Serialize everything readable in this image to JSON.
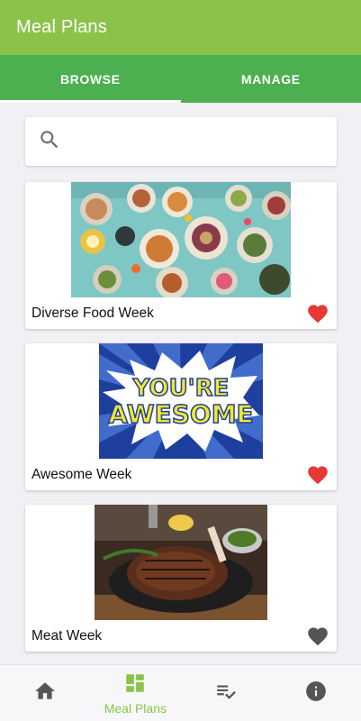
{
  "appbar": {
    "title": "Meal Plans"
  },
  "tabs": [
    {
      "label": "BROWSE",
      "active": true
    },
    {
      "label": "MANAGE",
      "active": false
    }
  ],
  "search": {
    "placeholder": "",
    "icon": "search-icon"
  },
  "meal_plans": [
    {
      "title": "Diverse Food Week",
      "favorite": true,
      "image": "food-spread-photo"
    },
    {
      "title": "Awesome Week",
      "favorite": true,
      "image": "youre-awesome-comic-image",
      "image_text": "YOU'RE AWESOME"
    },
    {
      "title": "Meat Week",
      "favorite": false,
      "image": "steak-photo"
    }
  ],
  "bottom_nav": [
    {
      "icon": "home-icon",
      "label": "",
      "active": false
    },
    {
      "icon": "dashboard-icon",
      "label": "Meal Plans",
      "active": true
    },
    {
      "icon": "playlist-check-icon",
      "label": "",
      "active": false
    },
    {
      "icon": "info-icon",
      "label": "",
      "active": false
    }
  ],
  "colors": {
    "appbar": "#8bc34a",
    "tabbar": "#4caf50",
    "favorite_on": "#e53935",
    "favorite_off": "#555555",
    "nav_active": "#8bc34a",
    "nav_inactive": "#555555"
  }
}
